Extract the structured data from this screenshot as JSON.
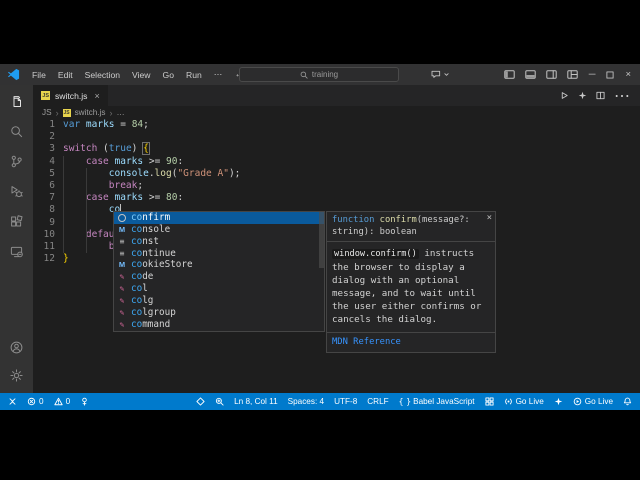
{
  "colors": {
    "statusbar": "#007acc",
    "editor_bg": "#1e1e1e",
    "titlebar_bg": "#323233",
    "activitybar_bg": "#333333",
    "tabbar_bg": "#252526",
    "suggest_selected": "#0a5a9c",
    "link": "#3794ff",
    "match": "#3da9f5"
  },
  "titlebar": {
    "menus": [
      "File",
      "Edit",
      "Selection",
      "View",
      "Go",
      "Run"
    ],
    "overflow": "⋯",
    "nav": {
      "back": "←",
      "forward": "→"
    },
    "search_label": "training",
    "right_icons": [
      "chat-icon",
      "layout-sidebar-left-icon",
      "layout-panel-icon",
      "layout-sidebar-right-icon",
      "layout-customize-icon"
    ],
    "window_controls": {
      "minimize": "─",
      "maximize": "maximize-icon",
      "close": "×"
    }
  },
  "activitybar": {
    "top": [
      {
        "name": "explorer-icon",
        "active": true
      },
      {
        "name": "search-icon"
      },
      {
        "name": "source-control-icon"
      },
      {
        "name": "run-debug-icon"
      },
      {
        "name": "extensions-icon"
      },
      {
        "name": "remote-explorer-icon"
      }
    ],
    "bottom": [
      {
        "name": "accounts-icon"
      },
      {
        "name": "settings-gear-icon"
      }
    ]
  },
  "tabbar": {
    "tab": {
      "label": "switch.js",
      "close": "×"
    },
    "actions": [
      "run-icon",
      "sparkle-icon",
      "split-editor-icon",
      "more-icon"
    ]
  },
  "breadcrumb": {
    "root": "JS",
    "file": "switch.js",
    "symbol": "…",
    "separator": "›"
  },
  "editor": {
    "lines": [
      {
        "n": "1",
        "tokens": [
          [
            "kw1",
            "var"
          ],
          [
            "pln",
            " "
          ],
          [
            "var",
            "marks"
          ],
          [
            "pln",
            " = "
          ],
          [
            "num",
            "84"
          ],
          [
            "pln",
            ";"
          ]
        ]
      },
      {
        "n": "2",
        "tokens": []
      },
      {
        "n": "3",
        "tokens": [
          [
            "kw2",
            "switch"
          ],
          [
            "pln",
            " ("
          ],
          [
            "kw1",
            "true"
          ],
          [
            "pln",
            ") "
          ],
          [
            "bracehl",
            "{"
          ]
        ]
      },
      {
        "n": "4",
        "tokens": [
          [
            "pln",
            "    "
          ],
          [
            "kw2",
            "case"
          ],
          [
            "pln",
            " "
          ],
          [
            "var",
            "marks"
          ],
          [
            "pln",
            " >= "
          ],
          [
            "num",
            "90"
          ],
          [
            "pln",
            ":"
          ]
        ]
      },
      {
        "n": "5",
        "tokens": [
          [
            "pln",
            "        "
          ],
          [
            "var",
            "console"
          ],
          [
            "pln",
            "."
          ],
          [
            "fn",
            "log"
          ],
          [
            "pln",
            "("
          ],
          [
            "str",
            "\"Grade A\""
          ],
          [
            "pln",
            ");"
          ]
        ]
      },
      {
        "n": "6",
        "tokens": [
          [
            "pln",
            "        "
          ],
          [
            "kw2",
            "break"
          ],
          [
            "pln",
            ";"
          ]
        ]
      },
      {
        "n": "7",
        "tokens": [
          [
            "pln",
            "    "
          ],
          [
            "kw2",
            "case"
          ],
          [
            "pln",
            " "
          ],
          [
            "var",
            "marks"
          ],
          [
            "pln",
            " >= "
          ],
          [
            "num",
            "80"
          ],
          [
            "pln",
            ":"
          ]
        ]
      },
      {
        "n": "8",
        "tokens": [
          [
            "pln",
            "        "
          ],
          [
            "var",
            "co"
          ],
          [
            "cursor",
            ""
          ]
        ]
      },
      {
        "n": "9",
        "tokens": []
      },
      {
        "n": "10",
        "tokens": [
          [
            "pln",
            "    "
          ],
          [
            "kw2",
            "default"
          ],
          [
            "pln",
            ":"
          ]
        ]
      },
      {
        "n": "11",
        "tokens": [
          [
            "pln",
            "        "
          ],
          [
            "kw2",
            "break"
          ],
          [
            "pln",
            ";"
          ]
        ]
      },
      {
        "n": "12",
        "tokens": [
          [
            "brace",
            "}"
          ]
        ]
      }
    ]
  },
  "autocomplete": {
    "match_prefix": "co",
    "items": [
      {
        "kind": "method",
        "label": "confirm",
        "selected": true
      },
      {
        "kind": "field",
        "label": "console"
      },
      {
        "kind": "keyword",
        "label": "const"
      },
      {
        "kind": "keyword",
        "label": "continue"
      },
      {
        "kind": "field",
        "label": "cookieStore"
      },
      {
        "kind": "property",
        "label": "code"
      },
      {
        "kind": "property",
        "label": "col"
      },
      {
        "kind": "property",
        "label": "colg"
      },
      {
        "kind": "property",
        "label": "colgroup"
      },
      {
        "kind": "property",
        "label": "command"
      }
    ]
  },
  "docpopup": {
    "sig_keyword": "function ",
    "sig_name": "confirm",
    "sig_rest": "(message?: string): boolean",
    "close": "×",
    "body_code": "window.confirm()",
    "body_text": " instructs the browser to display a dialog with an optional message, and to wait until the user either confirms or cancels the dialog.",
    "link": "MDN Reference"
  },
  "statusbar": {
    "left": [
      {
        "icon": "remote-icon",
        "name": "remote-indicator"
      },
      {
        "icon": "error-icon",
        "text": "0",
        "name": "errors-count"
      },
      {
        "icon": "warning-icon",
        "text": "0",
        "name": "warnings-count"
      },
      {
        "icon": "live-share-icon",
        "name": "live-share"
      }
    ],
    "right": [
      {
        "icon": "screencast-icon",
        "name": "screencast"
      },
      {
        "icon": "zoom-icon",
        "name": "zoom-indicator"
      },
      {
        "text": "Ln 8, Col 11",
        "name": "cursor-position"
      },
      {
        "text": "Spaces: 4",
        "name": "indentation"
      },
      {
        "text": "UTF-8",
        "name": "encoding"
      },
      {
        "text": "CRLF",
        "name": "eol"
      },
      {
        "icon": "braces-icon",
        "text": "Babel JavaScript",
        "name": "language-mode"
      },
      {
        "icon": "ports-icon",
        "name": "ports"
      },
      {
        "icon": "broadcast-icon",
        "text": "Go Live",
        "name": "go-live-broadcast"
      },
      {
        "icon": "sparkle-status-icon",
        "name": "sparkle-status"
      },
      {
        "icon": "play-circle-icon",
        "text": "Go Live",
        "name": "go-live-play"
      },
      {
        "icon": "bell-icon",
        "name": "notifications-bell"
      }
    ]
  }
}
